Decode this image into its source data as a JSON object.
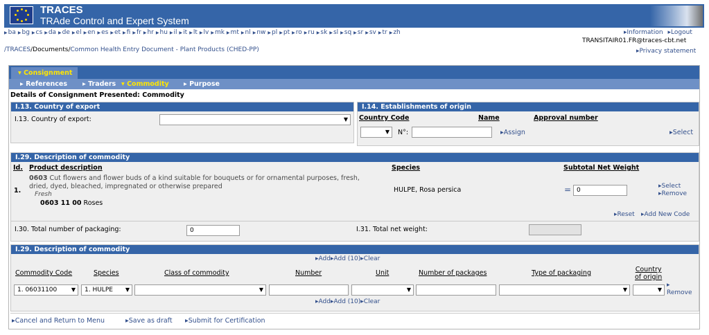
{
  "header": {
    "app_title": "TRACES",
    "app_subtitle": "TRAde Control and Expert System"
  },
  "languages": [
    "ba",
    "bg",
    "cs",
    "da",
    "de",
    "el",
    "en",
    "es",
    "et",
    "fi",
    "fr",
    "hr",
    "hu",
    "il",
    "it",
    "lt",
    "lv",
    "mk",
    "mt",
    "nl",
    "nw",
    "pl",
    "pt",
    "ro",
    "ru",
    "sk",
    "sl",
    "sq",
    "sr",
    "sv",
    "tr",
    "zh"
  ],
  "top_links": {
    "information": "Information",
    "logout": "Logout"
  },
  "user": "TRANSITAIR01.FR@traces-cbt.net",
  "breadcrumb": {
    "root": "/TRACES",
    "documents": "/Documents/",
    "current": "Common Health Entry Document - Plant Products (CHED-PP)"
  },
  "privacy_link": "Privacy statement",
  "tabs": {
    "consignment": "Consignment",
    "sub": [
      {
        "label": "References",
        "active": false
      },
      {
        "label": "Traders",
        "active": false
      },
      {
        "label": "Commodity",
        "active": true
      },
      {
        "label": "Purpose",
        "active": false
      }
    ]
  },
  "details_title": "Details of Consignment Presented: Commodity",
  "export": {
    "header": "I.13. Country of export",
    "label": "I.13. Country of export:",
    "value": ""
  },
  "establishments": {
    "header": "I.14. Establishments of origin",
    "col_country_code": "Country Code",
    "col_name": "Name",
    "col_approval": "Approval number",
    "no_label": "N°:",
    "no_value": "",
    "assign": "Assign",
    "select": "Select"
  },
  "description1": {
    "header": "I.29. Description of commodity",
    "col_id": "Id.",
    "col_product": "Product description",
    "col_species": "Species",
    "col_subtotal": "Subtotal Net Weight",
    "row": {
      "id": "1.",
      "code": "0603",
      "desc": "Cut flowers and flower buds of a kind suitable for bouquets or for ornamental purposes, fresh, dried, dyed, bleached, impregnated or otherwise prepared",
      "sub": "Fresh",
      "subcode": "0603 11 00",
      "subname": "Roses",
      "species": "HULPE, Rosa persica",
      "eq": "=",
      "weight": "0",
      "select": "Select",
      "remove": "Remove"
    },
    "reset": "Reset",
    "add_new_code": "Add New Code"
  },
  "totals": {
    "packaging_label": "I.30. Total number of packaging:",
    "packaging_value": "0",
    "net_weight_label": "I.31. Total net weight:",
    "net_weight_value": ""
  },
  "description2": {
    "header": "I.29. Description of commodity",
    "add": "Add",
    "add10": "Add (10)",
    "clear": "Clear",
    "columns": {
      "code": "Commodity Code",
      "species": "Species",
      "class": "Class of commodity",
      "number": "Number",
      "unit": "Unit",
      "packages": "Number of packages",
      "packaging": "Type of packaging",
      "origin_line1": "Country",
      "origin_line2": "of origin"
    },
    "row": {
      "code": "1. 06031100",
      "species": "1. HULPE",
      "class": "",
      "number": "",
      "unit": "",
      "packages": "",
      "packaging": "",
      "origin": "",
      "remove": "Remove"
    }
  },
  "footer": {
    "cancel": "Cancel and Return to Menu",
    "save": "Save as draft",
    "submit": "Submit for Certification"
  }
}
